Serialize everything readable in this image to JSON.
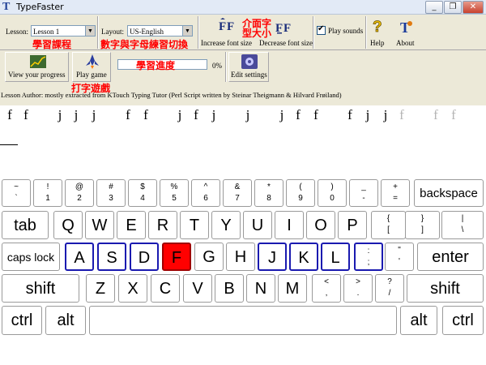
{
  "window": {
    "title": "TypeFaster",
    "icon": "T",
    "controls": [
      "_",
      "❐",
      "✕"
    ]
  },
  "toolbar": {
    "lesson_label": "Lesson:",
    "lesson_value": "Lesson 1",
    "layout_label": "Layout:",
    "layout_value": "US-English",
    "increase_font_label": "Increase font size",
    "decrease_font_label": "Decrease font size",
    "play_sounds_label": "Play sounds",
    "play_sounds_checked": true,
    "help_label": "Help",
    "about_label": "About",
    "view_progress_label": "View your progress",
    "play_game_label": "Play game",
    "progress_percent": "0%",
    "progress_value": 0,
    "edit_settings_label": "Edit settings"
  },
  "annotations": {
    "lesson": "學習課程",
    "layout": "數字與字母練習切換",
    "font_size": "介面字型大小",
    "progress": "學習進度",
    "game": "打字遊戲"
  },
  "lesson_author": "Lesson Author: mostly extracted from KTouch Typing Tutor (Perl Script written by Steinar Theigmann & Hilvard Frøiland)",
  "exercise": {
    "typed": [
      "f",
      "f",
      "j",
      "j",
      "j",
      "f",
      "f",
      "j",
      "f",
      "j",
      "j",
      "j",
      "f",
      "f",
      "f",
      "j",
      "j"
    ],
    "pending": [
      "f",
      "f",
      "f"
    ]
  },
  "keyboard": {
    "row1": [
      {
        "top": "~",
        "bottom": "`"
      },
      {
        "top": "!",
        "bottom": "1"
      },
      {
        "top": "@",
        "bottom": "2"
      },
      {
        "top": "#",
        "bottom": "3"
      },
      {
        "top": "$",
        "bottom": "4"
      },
      {
        "top": "%",
        "bottom": "5"
      },
      {
        "top": "^",
        "bottom": "6"
      },
      {
        "top": "&",
        "bottom": "7"
      },
      {
        "top": "*",
        "bottom": "8"
      },
      {
        "top": "(",
        "bottom": "9"
      },
      {
        "top": ")",
        "bottom": "0"
      },
      {
        "top": "_",
        "bottom": "-"
      },
      {
        "top": "+",
        "bottom": "="
      }
    ],
    "backspace": "backspace",
    "tab": "tab",
    "row2_letters": [
      "Q",
      "W",
      "E",
      "R",
      "T",
      "Y",
      "U",
      "I",
      "O",
      "P"
    ],
    "row2_syms": [
      {
        "top": "{",
        "bottom": "["
      },
      {
        "top": "}",
        "bottom": "]"
      },
      {
        "top": "|",
        "bottom": "\\"
      }
    ],
    "caps": "caps lock",
    "row3_letters": [
      "A",
      "S",
      "D",
      "F",
      "G",
      "H",
      "J",
      "K",
      "L"
    ],
    "row3_syms": [
      {
        "top": ":",
        "bottom": ";"
      },
      {
        "top": "\"",
        "bottom": "'"
      }
    ],
    "enter": "enter",
    "shift_left": "shift",
    "row4_letters": [
      "Z",
      "X",
      "C",
      "V",
      "B",
      "N",
      "M"
    ],
    "row4_syms": [
      {
        "top": "<",
        "bottom": ","
      },
      {
        "top": ">",
        "bottom": "."
      },
      {
        "top": "?",
        "bottom": "/"
      }
    ],
    "shift_right": "shift",
    "ctrl_left": "ctrl",
    "alt_left": "alt",
    "alt_right": "alt",
    "ctrl_right": "ctrl",
    "home_keys": [
      "A",
      "S",
      "D",
      "F",
      "J",
      "K",
      "L",
      ";"
    ],
    "active_key": "F"
  },
  "colors": {
    "active_key": "#ff0000",
    "home_key_border": "#1a1ab0",
    "annotation": "#ff0000",
    "toolbar_bg": "#ece9d8"
  }
}
